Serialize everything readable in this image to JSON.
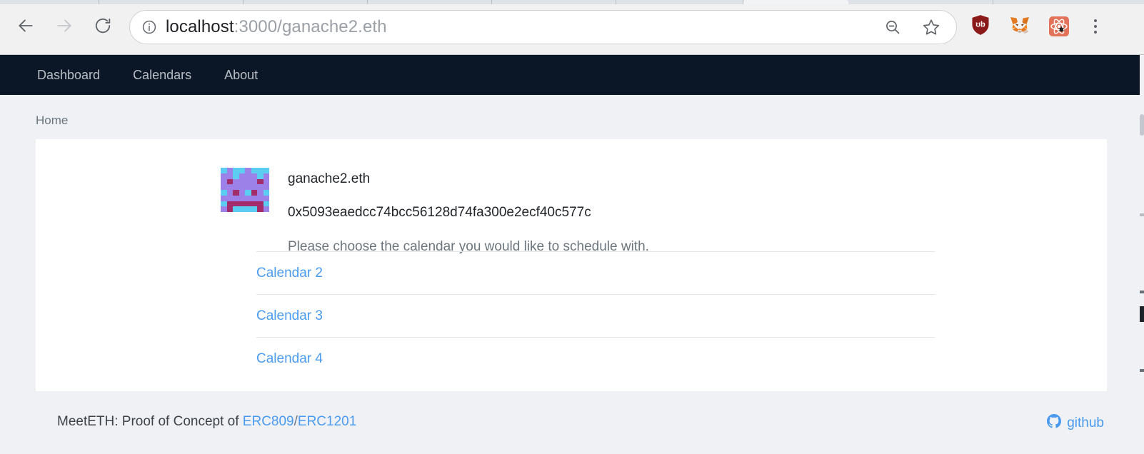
{
  "browser": {
    "back_icon": "arrow-left-icon",
    "forward_icon": "arrow-right-icon",
    "reload_icon": "reload-icon",
    "info_icon": "info-circle-icon",
    "url_host": "localhost",
    "url_rest": ":3000/ganache2.eth",
    "url_full": "localhost:3000/ganache2.eth",
    "zoom_out_icon": "zoom-out-icon",
    "bookmark_icon": "star-icon",
    "extensions": [
      {
        "name": "ublock-origin-extension",
        "label": "uBlock Origin",
        "color": "#8b1a1a"
      },
      {
        "name": "metamask-extension",
        "label": "MetaMask",
        "color": "#e2761b"
      },
      {
        "name": "react-devtools-extension",
        "label": "React Developer Tools",
        "color": "#e2735a"
      }
    ],
    "menu_icon": "three-dot-menu-icon"
  },
  "navbar": {
    "items": [
      {
        "label": "Dashboard"
      },
      {
        "label": "Calendars"
      },
      {
        "label": "About"
      }
    ]
  },
  "breadcrumb": {
    "label": "Home"
  },
  "profile": {
    "avatar_icon": "blockie-identicon",
    "ens_name": "ganache2.eth",
    "address": "0x5093eaedcc74bcc56128d74fa300e2ecf40c577c",
    "prompt": "Please choose the calendar you would like to schedule with.",
    "blockie_colors": {
      "background": "#5bcdf0",
      "primary": "#9b81e8",
      "spots": "#a32d6b"
    },
    "blockie_grid": [
      [
        0,
        1,
        0,
        0,
        1,
        0,
        0,
        0
      ],
      [
        1,
        1,
        0,
        1,
        1,
        1,
        0,
        1
      ],
      [
        1,
        2,
        1,
        1,
        1,
        1,
        2,
        1
      ],
      [
        1,
        1,
        1,
        1,
        1,
        1,
        1,
        1
      ],
      [
        0,
        1,
        2,
        1,
        0,
        2,
        1,
        0
      ],
      [
        1,
        1,
        1,
        1,
        1,
        1,
        1,
        1
      ],
      [
        0,
        2,
        2,
        2,
        2,
        2,
        2,
        0
      ],
      [
        1,
        2,
        0,
        0,
        0,
        0,
        2,
        1
      ]
    ]
  },
  "calendars": [
    {
      "label": "Calendar 2"
    },
    {
      "label": "Calendar 3"
    },
    {
      "label": "Calendar 4"
    }
  ],
  "footer": {
    "text_prefix": "MeetETH: Proof of Concept of ",
    "link1": "ERC809",
    "separator": "/",
    "link2": "ERC1201",
    "github_icon": "github-icon",
    "github_label": "github"
  },
  "colors": {
    "navbar_bg": "#0b1726",
    "page_bg": "#f0f1f5",
    "card_bg": "#ffffff",
    "link": "#4a9bf0",
    "muted_text": "#6c757d"
  }
}
